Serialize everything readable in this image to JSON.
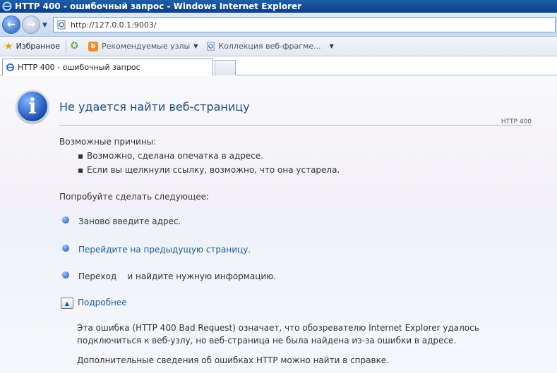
{
  "window": {
    "title": "HTTP 400 - ошибочный запрос - Windows Internet Explorer"
  },
  "address": {
    "url": "http://127.0.0.1:9003/"
  },
  "favorites_bar": {
    "favorites_label": "Избранное",
    "suggested_sites": "Рекомендуемые узлы",
    "web_slice_gallery": "Коллекция веб-фрагме..."
  },
  "tabs": [
    {
      "label": "HTTP 400 - ошибочный запрос"
    }
  ],
  "page": {
    "heading": "Не удается найти веб-страницу",
    "http_code": "HTTP 400",
    "causes_title": "Возможные причины:",
    "causes": [
      "Возможно, сделана опечатка в адресе.",
      "Если вы щелкнули ссылку, возможно, что она устарела."
    ],
    "try_title": "Попробуйте сделать следующее:",
    "actions": [
      {
        "label": "Заново введите адрес.",
        "is_link": false
      },
      {
        "label": "Перейдите на предыдущую страницу.",
        "is_link": true
      },
      {
        "label": "Переход    и найдите нужную информацию.",
        "is_link": false
      }
    ],
    "more_info_label": "Подробнее",
    "details_text": "Эта ошибка (HTTP 400 Bad Request) означает, что обозревателю Internet Explorer удалось подключиться к веб-узлу, но веб-страница не была найдена из-за ошибки в адресе.",
    "help_text": "Дополнительные сведения об ошибках HTTP можно найти в справке."
  }
}
